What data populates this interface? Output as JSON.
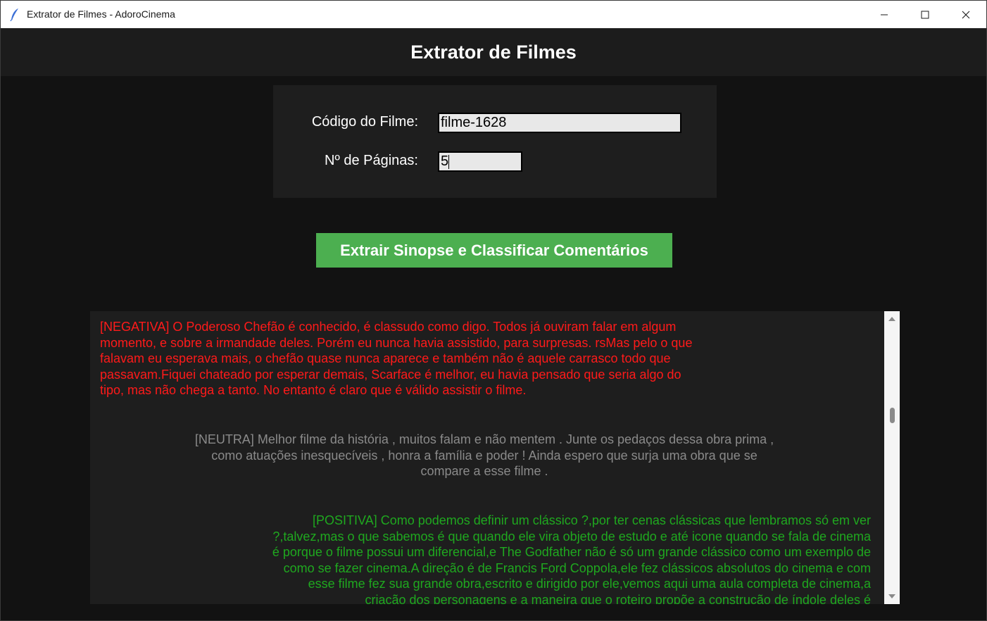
{
  "window": {
    "title": "Extrator de Filmes - AdoroCinema",
    "app_icon": "feather-icon",
    "controls": [
      "minimize-icon",
      "maximize-icon",
      "close-icon"
    ]
  },
  "header": {
    "title": "Extrator de Filmes"
  },
  "form": {
    "code_label": "Código do Filme:",
    "code_value": "filme-1628",
    "pages_label": "Nº de Páginas:",
    "pages_value": "5"
  },
  "action_button": {
    "label": "Extrair Sinopse e Classificar Comentários",
    "color": "#4caf50"
  },
  "output": {
    "comments": [
      {
        "sentiment": "NEGATIVA",
        "color": "#ff1a1a",
        "text": "[NEGATIVA] O Poderoso Chefão é conhecido, é classudo como digo. Todos já ouviram falar em algum\nmomento, e sobre a irmandade deles. Porém eu nunca havia assistido, para surpresas. rsMas pelo o que\nfalavam eu esperava mais, o chefão quase nunca aparece e também não é aquele carrasco todo que\npassavam.Fiquei chateado por esperar demais, Scarface é melhor, eu havia pensado que seria algo do\ntipo, mas não chega a tanto. No entanto é claro que é válido assistir o filme."
      },
      {
        "sentiment": "NEUTRA",
        "color": "#8a8a8a",
        "text": "[NEUTRA] Melhor filme da história , muitos falam e não mentem . Junte os pedaços dessa obra prima ,\ncomo  atuações inesquecíveis , honra a família e poder ! Ainda espero que surja uma obra que se\ncompare a esse filme ."
      },
      {
        "sentiment": "POSITIVA",
        "color": "#1fa81f",
        "text": "[POSITIVA] Como podemos definir um clássico ?,por ter cenas clássicas que lembramos só em ver\n?,talvez,mas o que sabemos é que quando ele vira objeto de estudo e até icone quando se fala de cinema\né porque o filme possui um diferencial,e The Godfather não é só um grande clássico como um exemplo de\ncomo se fazer cinema.A direção é de Francis Ford Coppola,ele fez clássicos absolutos do cinema e com\nesse filme fez sua grande obra,escrito e dirigido por ele,vemos aqui uma aula completa de cinema,a\ncriação dos personagens e a maneira que o roteiro propõe a construção de índole deles é"
      }
    ]
  },
  "scrollbar": {
    "up_icon": "scroll-up-arrow-icon",
    "down_icon": "scroll-down-arrow-icon"
  }
}
